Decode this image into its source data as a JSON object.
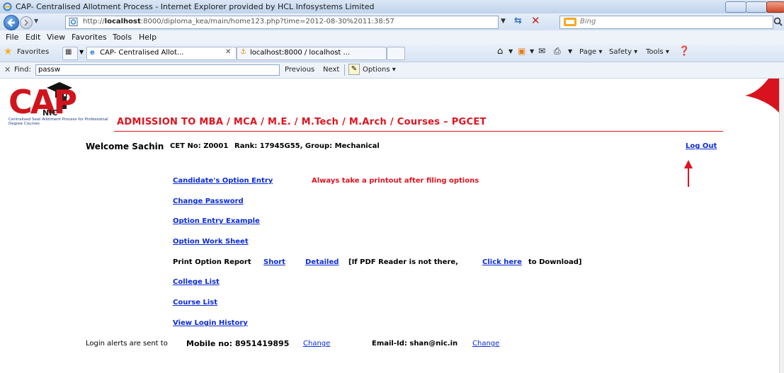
{
  "window": {
    "title": "CAP- Centralised Allotment Process - Internet Explorer provided by HCL Infosystems Limited"
  },
  "address_bar": {
    "url_prefix": "http://",
    "url_host": "localhost",
    "url_rest": ":8000/diploma_kea/main/home123.php?time=2012-08-30%2011:38:57",
    "search_placeholder": "Bing"
  },
  "menu": [
    "File",
    "Edit",
    "View",
    "Favorites",
    "Tools",
    "Help"
  ],
  "favorites_bar": {
    "favorites_label": "Favorites",
    "tabs": [
      "CAP- Centralised Allot...",
      "localhost:8000 / localhost ..."
    ],
    "commands": [
      "Page",
      "Safety",
      "Tools"
    ]
  },
  "find_bar": {
    "label": "Find:",
    "value": "passw",
    "previous": "Previous",
    "next": "Next",
    "options": "Options"
  },
  "logo": {
    "cap": "CAP",
    "nic": "NIC",
    "subtitle": "Centralised Seat Allotment Process for Professional Degree Courses"
  },
  "header": {
    "admission_title": "ADMISSION TO MBA / MCA / M.E. / M.Tech / M.Arch / Courses – PGCET"
  },
  "user": {
    "welcome": "Welcome Sachin",
    "cet_no": "CET No: Z0001",
    "rank_group": "Rank: 17945G55, Group: Mechanical",
    "logout": "Log Out"
  },
  "links": {
    "option_entry": "Candidate's Option Entry",
    "printout_note": "Always take a printout after filing options",
    "change_password": "Change Password",
    "option_example": "Option Entry Example",
    "work_sheet": "Option Work Sheet",
    "print_report_label": "Print Option Report",
    "short": "Short",
    "detailed": "Detailed",
    "pdf_note_pre": "[If PDF Reader is not there,",
    "click_here": "Click here",
    "pdf_note_post": "to Download]",
    "college_list": "College List",
    "course_list": "Course List",
    "login_history": "View  Login History"
  },
  "footer": {
    "alerts_pre": "Login alerts are sent to",
    "mobile": "Mobile no: 8951419895",
    "change1": "Change",
    "email": "Email-Id: shan@nic.in",
    "change2": "Change"
  },
  "colors": {
    "accent_red": "#e0131e",
    "link_blue": "#0b2bd6"
  }
}
